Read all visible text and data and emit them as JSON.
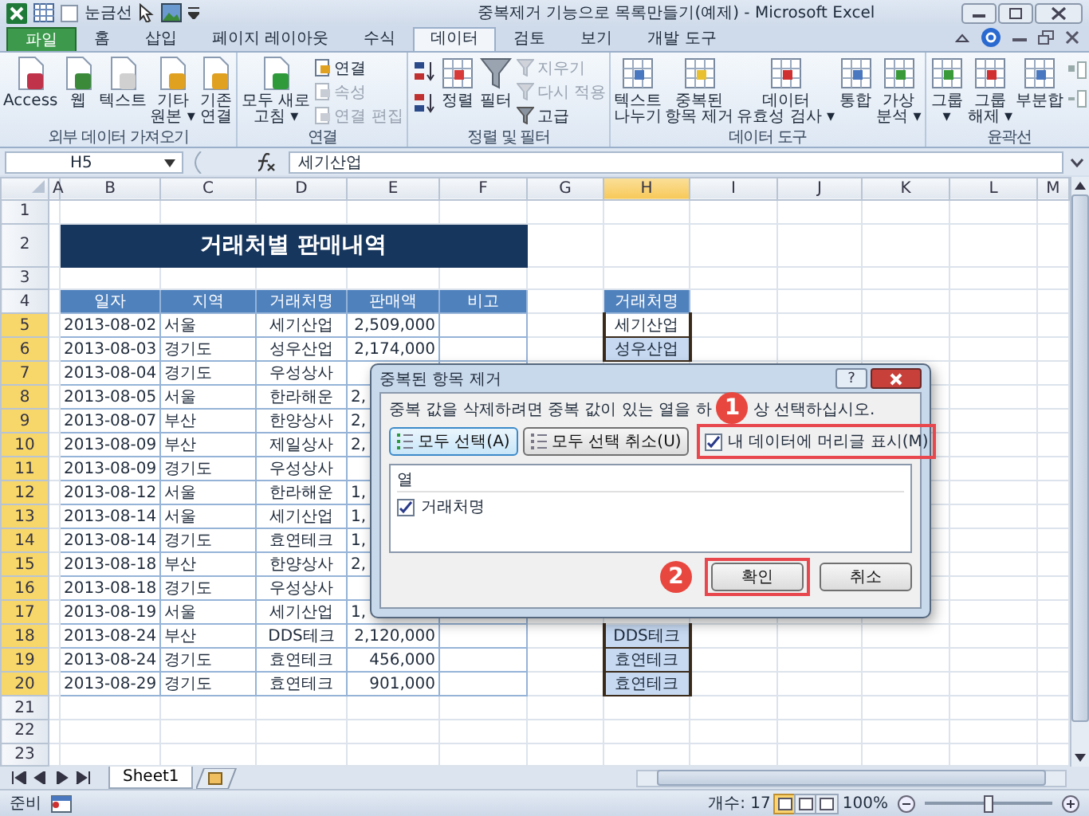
{
  "window": {
    "title": "중복제거 기능으로 목록만들기(예제) - Microsoft Excel"
  },
  "quick_access": {
    "gridlines": {
      "label": "눈금선",
      "checked": false
    }
  },
  "ribbon_tabs": [
    {
      "label": "파일",
      "kind": "file",
      "selected": false
    },
    {
      "label": "홈",
      "kind": "tab",
      "selected": false
    },
    {
      "label": "삽입",
      "kind": "tab",
      "selected": false
    },
    {
      "label": "페이지 레이아웃",
      "kind": "tab",
      "selected": false
    },
    {
      "label": "수식",
      "kind": "tab",
      "selected": false
    },
    {
      "label": "데이터",
      "kind": "tab",
      "selected": true
    },
    {
      "label": "검토",
      "kind": "tab",
      "selected": false
    },
    {
      "label": "보기",
      "kind": "tab",
      "selected": false
    },
    {
      "label": "개발 도구",
      "kind": "tab",
      "selected": false
    }
  ],
  "ribbon_groups": [
    {
      "label": "외부 데이터 가져오기",
      "items": [
        {
          "kind": "big",
          "lines": [
            "Access"
          ]
        },
        {
          "kind": "big",
          "lines": [
            "웹"
          ]
        },
        {
          "kind": "big",
          "lines": [
            "텍스트"
          ]
        },
        {
          "kind": "big",
          "lines": [
            "기타",
            "원본 ▾"
          ]
        },
        {
          "kind": "big",
          "lines": [
            "기존",
            "연결"
          ]
        }
      ]
    },
    {
      "label": "연결",
      "items": [
        {
          "kind": "big",
          "lines": [
            "모두 새로",
            "고침 ▾"
          ]
        },
        {
          "kind": "small_stack",
          "items": [
            {
              "label": "연결",
              "disabled": false
            },
            {
              "label": "속성",
              "disabled": true
            },
            {
              "label": "연결 편집",
              "disabled": true
            }
          ]
        }
      ]
    },
    {
      "label": "정렬 및 필터",
      "items": [
        {
          "kind": "sort_stack"
        },
        {
          "kind": "big",
          "lines": [
            "정렬"
          ]
        },
        {
          "kind": "big",
          "lines": [
            "필터"
          ]
        },
        {
          "kind": "small_stack",
          "items": [
            {
              "label": "지우기",
              "disabled": true
            },
            {
              "label": "다시 적용",
              "disabled": true
            },
            {
              "label": "고급",
              "disabled": false
            }
          ]
        }
      ]
    },
    {
      "label": "데이터 도구",
      "items": [
        {
          "kind": "big",
          "lines": [
            "텍스트",
            "나누기"
          ]
        },
        {
          "kind": "big",
          "lines": [
            "중복된",
            "항목 제거"
          ]
        },
        {
          "kind": "big",
          "lines": [
            "데이터",
            "유효성 검사 ▾"
          ]
        },
        {
          "kind": "big",
          "lines": [
            "통합"
          ]
        },
        {
          "kind": "big",
          "lines": [
            "가상",
            "분석 ▾"
          ]
        }
      ]
    },
    {
      "label": "윤곽선",
      "items": [
        {
          "kind": "big",
          "lines": [
            "그룹",
            "▾"
          ]
        },
        {
          "kind": "big",
          "lines": [
            "그룹",
            "해제 ▾"
          ]
        },
        {
          "kind": "big",
          "lines": [
            "부분합"
          ]
        },
        {
          "kind": "icon_stack"
        }
      ]
    }
  ],
  "formula_bar": {
    "cell": "H5",
    "value": "세기산업"
  },
  "sheet": {
    "columns": [
      {
        "label": "A",
        "selected": false
      },
      {
        "label": "B",
        "selected": false
      },
      {
        "label": "C",
        "selected": false
      },
      {
        "label": "D",
        "selected": false
      },
      {
        "label": "E",
        "selected": false
      },
      {
        "label": "F",
        "selected": false
      },
      {
        "label": "G",
        "selected": false
      },
      {
        "label": "H",
        "selected": true
      },
      {
        "label": "I",
        "selected": false
      },
      {
        "label": "J",
        "selected": false
      },
      {
        "label": "K",
        "selected": false
      },
      {
        "label": "L",
        "selected": false
      },
      {
        "label": "M",
        "selected": false
      }
    ],
    "rows": [
      {
        "number": "1",
        "selected": false,
        "kind": "blank"
      },
      {
        "number": "2",
        "selected": false,
        "kind": "title",
        "title": "거래처별 판매내역"
      },
      {
        "number": "3",
        "selected": false,
        "kind": "blank"
      },
      {
        "number": "4",
        "selected": false,
        "kind": "header",
        "headers": [
          "일자",
          "지역",
          "거래처명",
          "판매액",
          "비고"
        ],
        "list_header": "거래처명"
      },
      {
        "number": "5",
        "selected": true,
        "kind": "data",
        "date": "2013-08-02",
        "region": "서울",
        "client": "세기산업",
        "amount": "2,509,000",
        "amount_clipped": false,
        "list_item": {
          "text": "세기산업",
          "active": true
        }
      },
      {
        "number": "6",
        "selected": true,
        "kind": "data",
        "date": "2013-08-03",
        "region": "경기도",
        "client": "성우산업",
        "amount": "2,174,000",
        "amount_clipped": false,
        "list_item": {
          "text": "성우산업",
          "active": false
        }
      },
      {
        "number": "7",
        "selected": true,
        "kind": "data",
        "date": "2013-08-04",
        "region": "경기도",
        "client": "우성상사"
      },
      {
        "number": "8",
        "selected": true,
        "kind": "data",
        "date": "2013-08-05",
        "region": "서울",
        "client": "한라해운",
        "amount": "2,",
        "amount_clipped": true
      },
      {
        "number": "9",
        "selected": true,
        "kind": "data",
        "date": "2013-08-07",
        "region": "부산",
        "client": "한양상사",
        "amount": "2,",
        "amount_clipped": true
      },
      {
        "number": "10",
        "selected": true,
        "kind": "data",
        "date": "2013-08-09",
        "region": "부산",
        "client": "제일상사",
        "amount": "2,",
        "amount_clipped": true
      },
      {
        "number": "11",
        "selected": true,
        "kind": "data",
        "date": "2013-08-09",
        "region": "경기도",
        "client": "우성상사"
      },
      {
        "number": "12",
        "selected": true,
        "kind": "data",
        "date": "2013-08-12",
        "region": "서울",
        "client": "한라해운",
        "amount": "1,",
        "amount_clipped": true
      },
      {
        "number": "13",
        "selected": true,
        "kind": "data",
        "date": "2013-08-14",
        "region": "서울",
        "client": "세기산업",
        "amount": "1,",
        "amount_clipped": true
      },
      {
        "number": "14",
        "selected": true,
        "kind": "data",
        "date": "2013-08-14",
        "region": "경기도",
        "client": "효연테크",
        "amount": "1,",
        "amount_clipped": true
      },
      {
        "number": "15",
        "selected": true,
        "kind": "data",
        "date": "2013-08-18",
        "region": "부산",
        "client": "한양상사",
        "amount": "2,",
        "amount_clipped": true
      },
      {
        "number": "16",
        "selected": true,
        "kind": "data",
        "date": "2013-08-18",
        "region": "경기도",
        "client": "우성상사"
      },
      {
        "number": "17",
        "selected": true,
        "kind": "data",
        "date": "2013-08-19",
        "region": "서울",
        "client": "세기산업",
        "amount": "1,",
        "amount_clipped": true
      },
      {
        "number": "18",
        "selected": true,
        "kind": "data",
        "date": "2013-08-24",
        "region": "부산",
        "client": "DDS테크",
        "amount": "2,120,000",
        "amount_clipped": false,
        "list_item": {
          "text": "DDS테크",
          "active": false
        }
      },
      {
        "number": "19",
        "selected": true,
        "kind": "data",
        "date": "2013-08-24",
        "region": "경기도",
        "client": "효연테크",
        "amount": "456,000",
        "amount_clipped": false,
        "list_item": {
          "text": "효연테크",
          "active": false
        }
      },
      {
        "number": "20",
        "selected": true,
        "kind": "data",
        "date": "2013-08-29",
        "region": "경기도",
        "client": "효연테크",
        "amount": "901,000",
        "amount_clipped": false,
        "list_item": {
          "text": "효연테크",
          "active": false
        }
      },
      {
        "number": "21",
        "selected": false,
        "kind": "blank"
      },
      {
        "number": "22",
        "selected": false,
        "kind": "blank"
      },
      {
        "number": "23",
        "selected": false,
        "kind": "blank"
      }
    ]
  },
  "dialog": {
    "title": "중복된 항목 제거",
    "help": "?",
    "message_parts": [
      "중복 값을 삭제하려면 중복 값이 있는 열을 하",
      "상 선택하십시오."
    ],
    "select_all": "모두 선택(A)",
    "unselect_all": "모두 선택 취소(U)",
    "header_checkbox": {
      "label": "내 데이터에 머리글 표시(M)",
      "checked": true
    },
    "list_header": "열",
    "columns": [
      {
        "label": "거래처명",
        "checked": true
      }
    ],
    "ok": "확인",
    "cancel": "취소"
  },
  "annotations": [
    {
      "number": "1"
    },
    {
      "number": "2"
    }
  ],
  "sheet_tabs": [
    {
      "label": "Sheet1",
      "selected": true
    }
  ],
  "status_bar": {
    "mode": "준비",
    "count": "개수: 17",
    "views": [
      {
        "selected": true
      },
      {
        "selected": false
      },
      {
        "selected": false
      }
    ],
    "zoom": {
      "label": "100%",
      "level": 0.5
    }
  }
}
